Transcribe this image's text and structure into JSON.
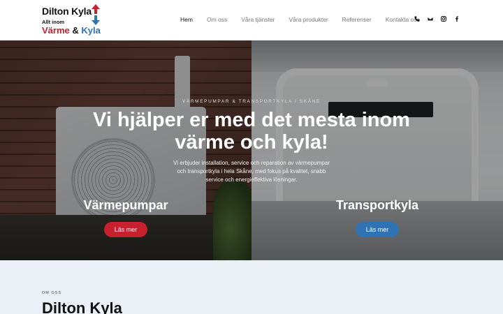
{
  "logo": {
    "line1": "Dilton Kyla",
    "line2": "Allt inom",
    "word1": "Värme",
    "amp": "&",
    "word2": "Kyla"
  },
  "nav": {
    "items": [
      {
        "label": "Hem",
        "active": true
      },
      {
        "label": "Om oss",
        "active": false
      },
      {
        "label": "Våra tjänster",
        "active": false
      },
      {
        "label": "Våra produkter",
        "active": false
      },
      {
        "label": "Referenser",
        "active": false
      },
      {
        "label": "Kontakta oss",
        "active": false
      }
    ]
  },
  "social": [
    "phone-icon",
    "email-icon",
    "instagram-icon",
    "facebook-icon"
  ],
  "hero": {
    "kicker": "VÄRMEPUMPAR & TRANSPORTKYLA I SKÅNE",
    "title": "Vi hjälper er med det mesta inom värme och kyla!",
    "description": "Vi erbjuder installation, service och reparation av värmepumpar och transportkyla i hela Skåne, med fokus på kvalitet, snabb service och energieffektiva lösningar."
  },
  "panels": {
    "left": {
      "title": "Värmepumpar",
      "button": "Läs mer"
    },
    "right": {
      "title": "Transportkyla",
      "button": "Läs mer"
    }
  },
  "about": {
    "kicker": "OM OSS",
    "title": "Dilton Kyla"
  },
  "colors": {
    "red": "#c8202f",
    "blue": "#2f73b5",
    "section_bg": "#ebf0f7"
  }
}
